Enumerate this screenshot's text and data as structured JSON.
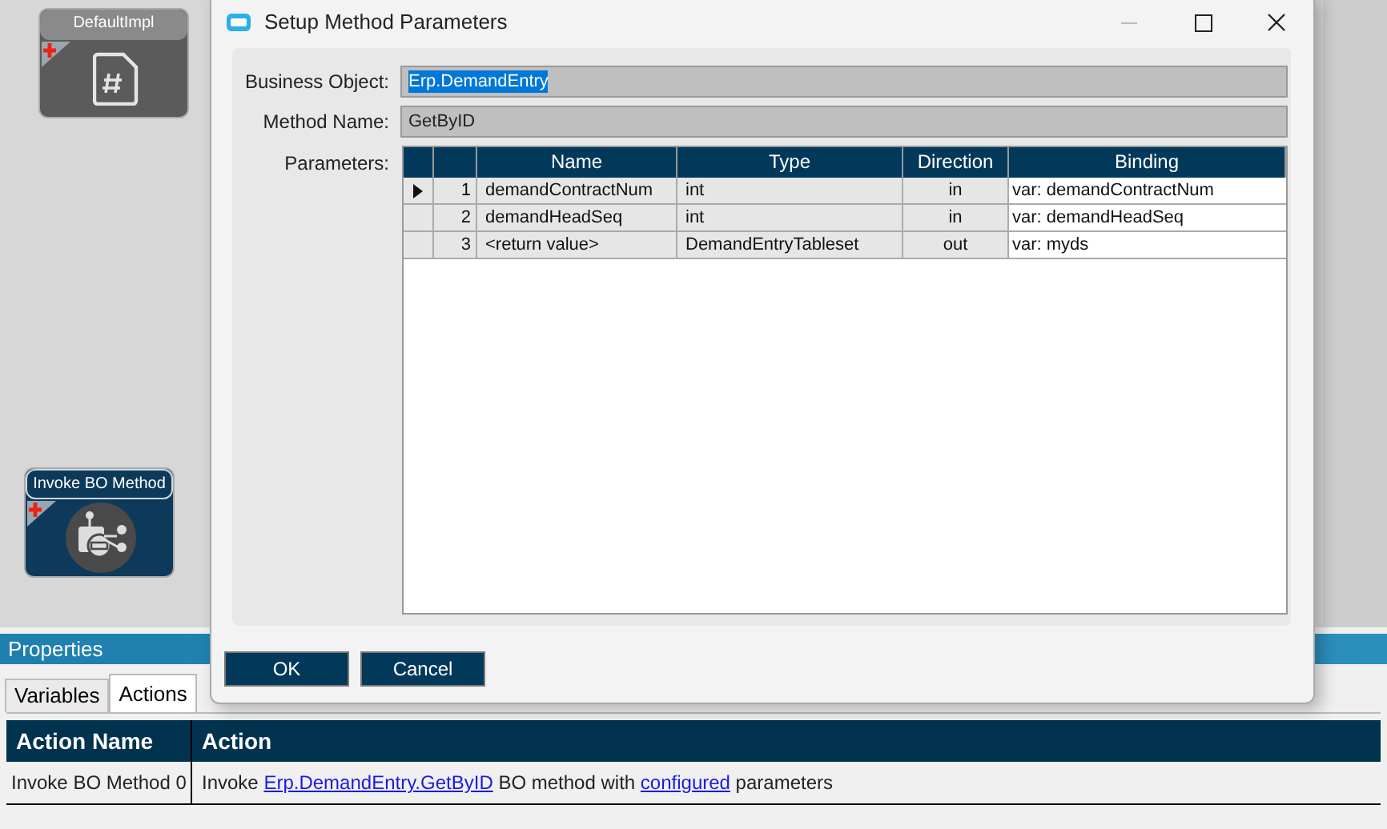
{
  "canvas": {
    "nodes": [
      {
        "kind": "file",
        "title": "DefaultImpl"
      },
      {
        "kind": "invoke",
        "title": "Invoke BO Method"
      }
    ]
  },
  "dialog": {
    "title": "Setup Method Parameters",
    "fields": [
      {
        "label": "Business Object:",
        "value": "Erp.DemandEntry",
        "text_selected": true
      },
      {
        "label": "Method Name:",
        "value": "GetByID",
        "text_selected": false
      }
    ],
    "parameters_label": "Parameters:",
    "grid": {
      "columns": [
        "Name",
        "Type",
        "Direction",
        "Binding"
      ],
      "rows": [
        {
          "current": true,
          "number": "1",
          "name": "demandContractNum",
          "type": "int",
          "direction": "in",
          "binding": "var: demandContractNum"
        },
        {
          "current": false,
          "number": "2",
          "name": "demandHeadSeq",
          "type": "int",
          "direction": "in",
          "binding": "var: demandHeadSeq"
        },
        {
          "current": false,
          "number": "3",
          "name": "<return value>",
          "type": "DemandEntryTableset",
          "direction": "out",
          "binding": "var: myds"
        }
      ]
    },
    "buttons": [
      "OK",
      "Cancel"
    ]
  },
  "properties": {
    "title": "Properties",
    "tabs": [
      {
        "label": "Variables",
        "selected": false
      },
      {
        "label": "Actions",
        "selected": true
      }
    ],
    "table": {
      "columns": [
        "Action Name",
        "Action"
      ],
      "rows": [
        {
          "name": "Invoke BO Method 0",
          "action": [
            {
              "kind": "text",
              "text": "Invoke "
            },
            {
              "kind": "link",
              "text": "Erp.DemandEntry.GetByID"
            },
            {
              "kind": "text",
              "text": " BO method with "
            },
            {
              "kind": "link",
              "text": "configured"
            },
            {
              "kind": "text",
              "text": " parameters"
            }
          ]
        }
      ]
    }
  }
}
